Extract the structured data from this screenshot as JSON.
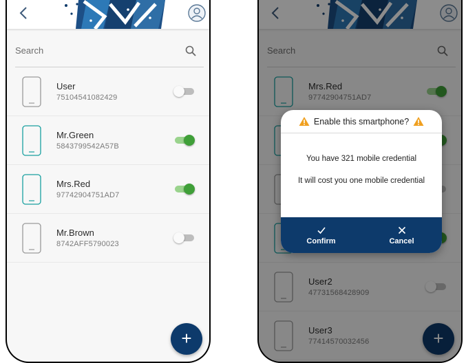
{
  "colors": {
    "primary": "#0d3a6b",
    "toggle_on": "#3f9f38",
    "active_device": "#18a0a0",
    "inactive_device": "#9a9a9a"
  },
  "icons": {
    "back": "chevron-left-icon",
    "profile": "user-circle-icon",
    "search": "search-icon",
    "add": "plus-icon",
    "warning": "warning-icon",
    "confirm": "check-icon",
    "cancel": "close-icon"
  },
  "left_screen": {
    "search": {
      "placeholder": "Search"
    },
    "devices": [
      {
        "name": "User",
        "serial": "75104541082429",
        "enabled": false
      },
      {
        "name": "Mr.Green",
        "serial": "5843799542A57B",
        "enabled": true
      },
      {
        "name": "Mrs.Red",
        "serial": "97742904751AD7",
        "enabled": true
      },
      {
        "name": "Mr.Brown",
        "serial": "8742AFF5790023",
        "enabled": false
      }
    ],
    "fab_label": "+"
  },
  "right_screen": {
    "search": {
      "placeholder": "Search"
    },
    "devices": [
      {
        "name": "Mrs.Red",
        "serial": "97742904751AD7",
        "enabled": true
      },
      {
        "name": "",
        "serial": "",
        "enabled": true
      },
      {
        "name": "",
        "serial": "",
        "enabled": false
      },
      {
        "name": "",
        "serial": "",
        "enabled": true
      },
      {
        "name": "User2",
        "serial": "47731568428909",
        "enabled": false
      },
      {
        "name": "User3",
        "serial": "77414570032456",
        "enabled": false
      }
    ],
    "fab_label": "+",
    "dialog": {
      "title": "Enable this smartphone?",
      "line1": "You have 321 mobile credential",
      "line2": "It will cost you one mobile credential",
      "confirm_label": "Confirm",
      "cancel_label": "Cancel"
    }
  }
}
